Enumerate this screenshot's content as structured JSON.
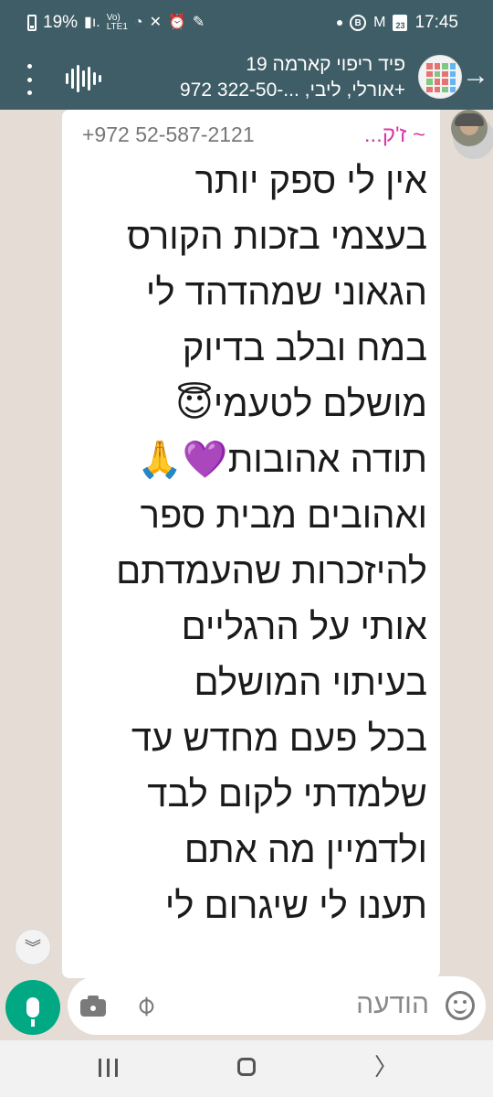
{
  "status_bar": {
    "battery": "19%",
    "network": "LTE1",
    "time": "17:45",
    "calendar_day": "23",
    "icons": [
      "battery-icon",
      "signal-icon",
      "volte-icon",
      "wifi-icon",
      "mute-icon",
      "alarm-icon",
      "edit-icon",
      "dot-icon",
      "b-badge-icon",
      "gmail-icon",
      "calendar-icon"
    ]
  },
  "header": {
    "title": "פיד ריפוי קארמה 19",
    "subtitle": "אורלי, ליבי, ...-322-50 972+"
  },
  "message": {
    "phone": "+972 52-587-2121",
    "sender_name": "~ ז'ק...",
    "lines": [
      "אין לי ספק יותר",
      "בעצמי בזכות הקורס",
      "הגאוני שמהדהד לי",
      "במח ובלב בדיוק",
      "מושלם לטעמי😇",
      "תודה אהובות💜🙏",
      "ואהובים מבית ספר",
      "להיזכרות שהעמדתם",
      "אותי על הרגליים",
      "בעיתוי המושלם",
      "בכל פעם מחדש עד",
      "שלמדתי לקום לבד",
      "ולדמיין מה אתם",
      "תענו לי שיגרום לי"
    ]
  },
  "input": {
    "placeholder": "הודעה"
  },
  "colors": {
    "header_bg": "#3f5d66",
    "chat_bg": "#e5ddd5",
    "accent": "#00a884",
    "sender_name": "#d63aa8"
  }
}
